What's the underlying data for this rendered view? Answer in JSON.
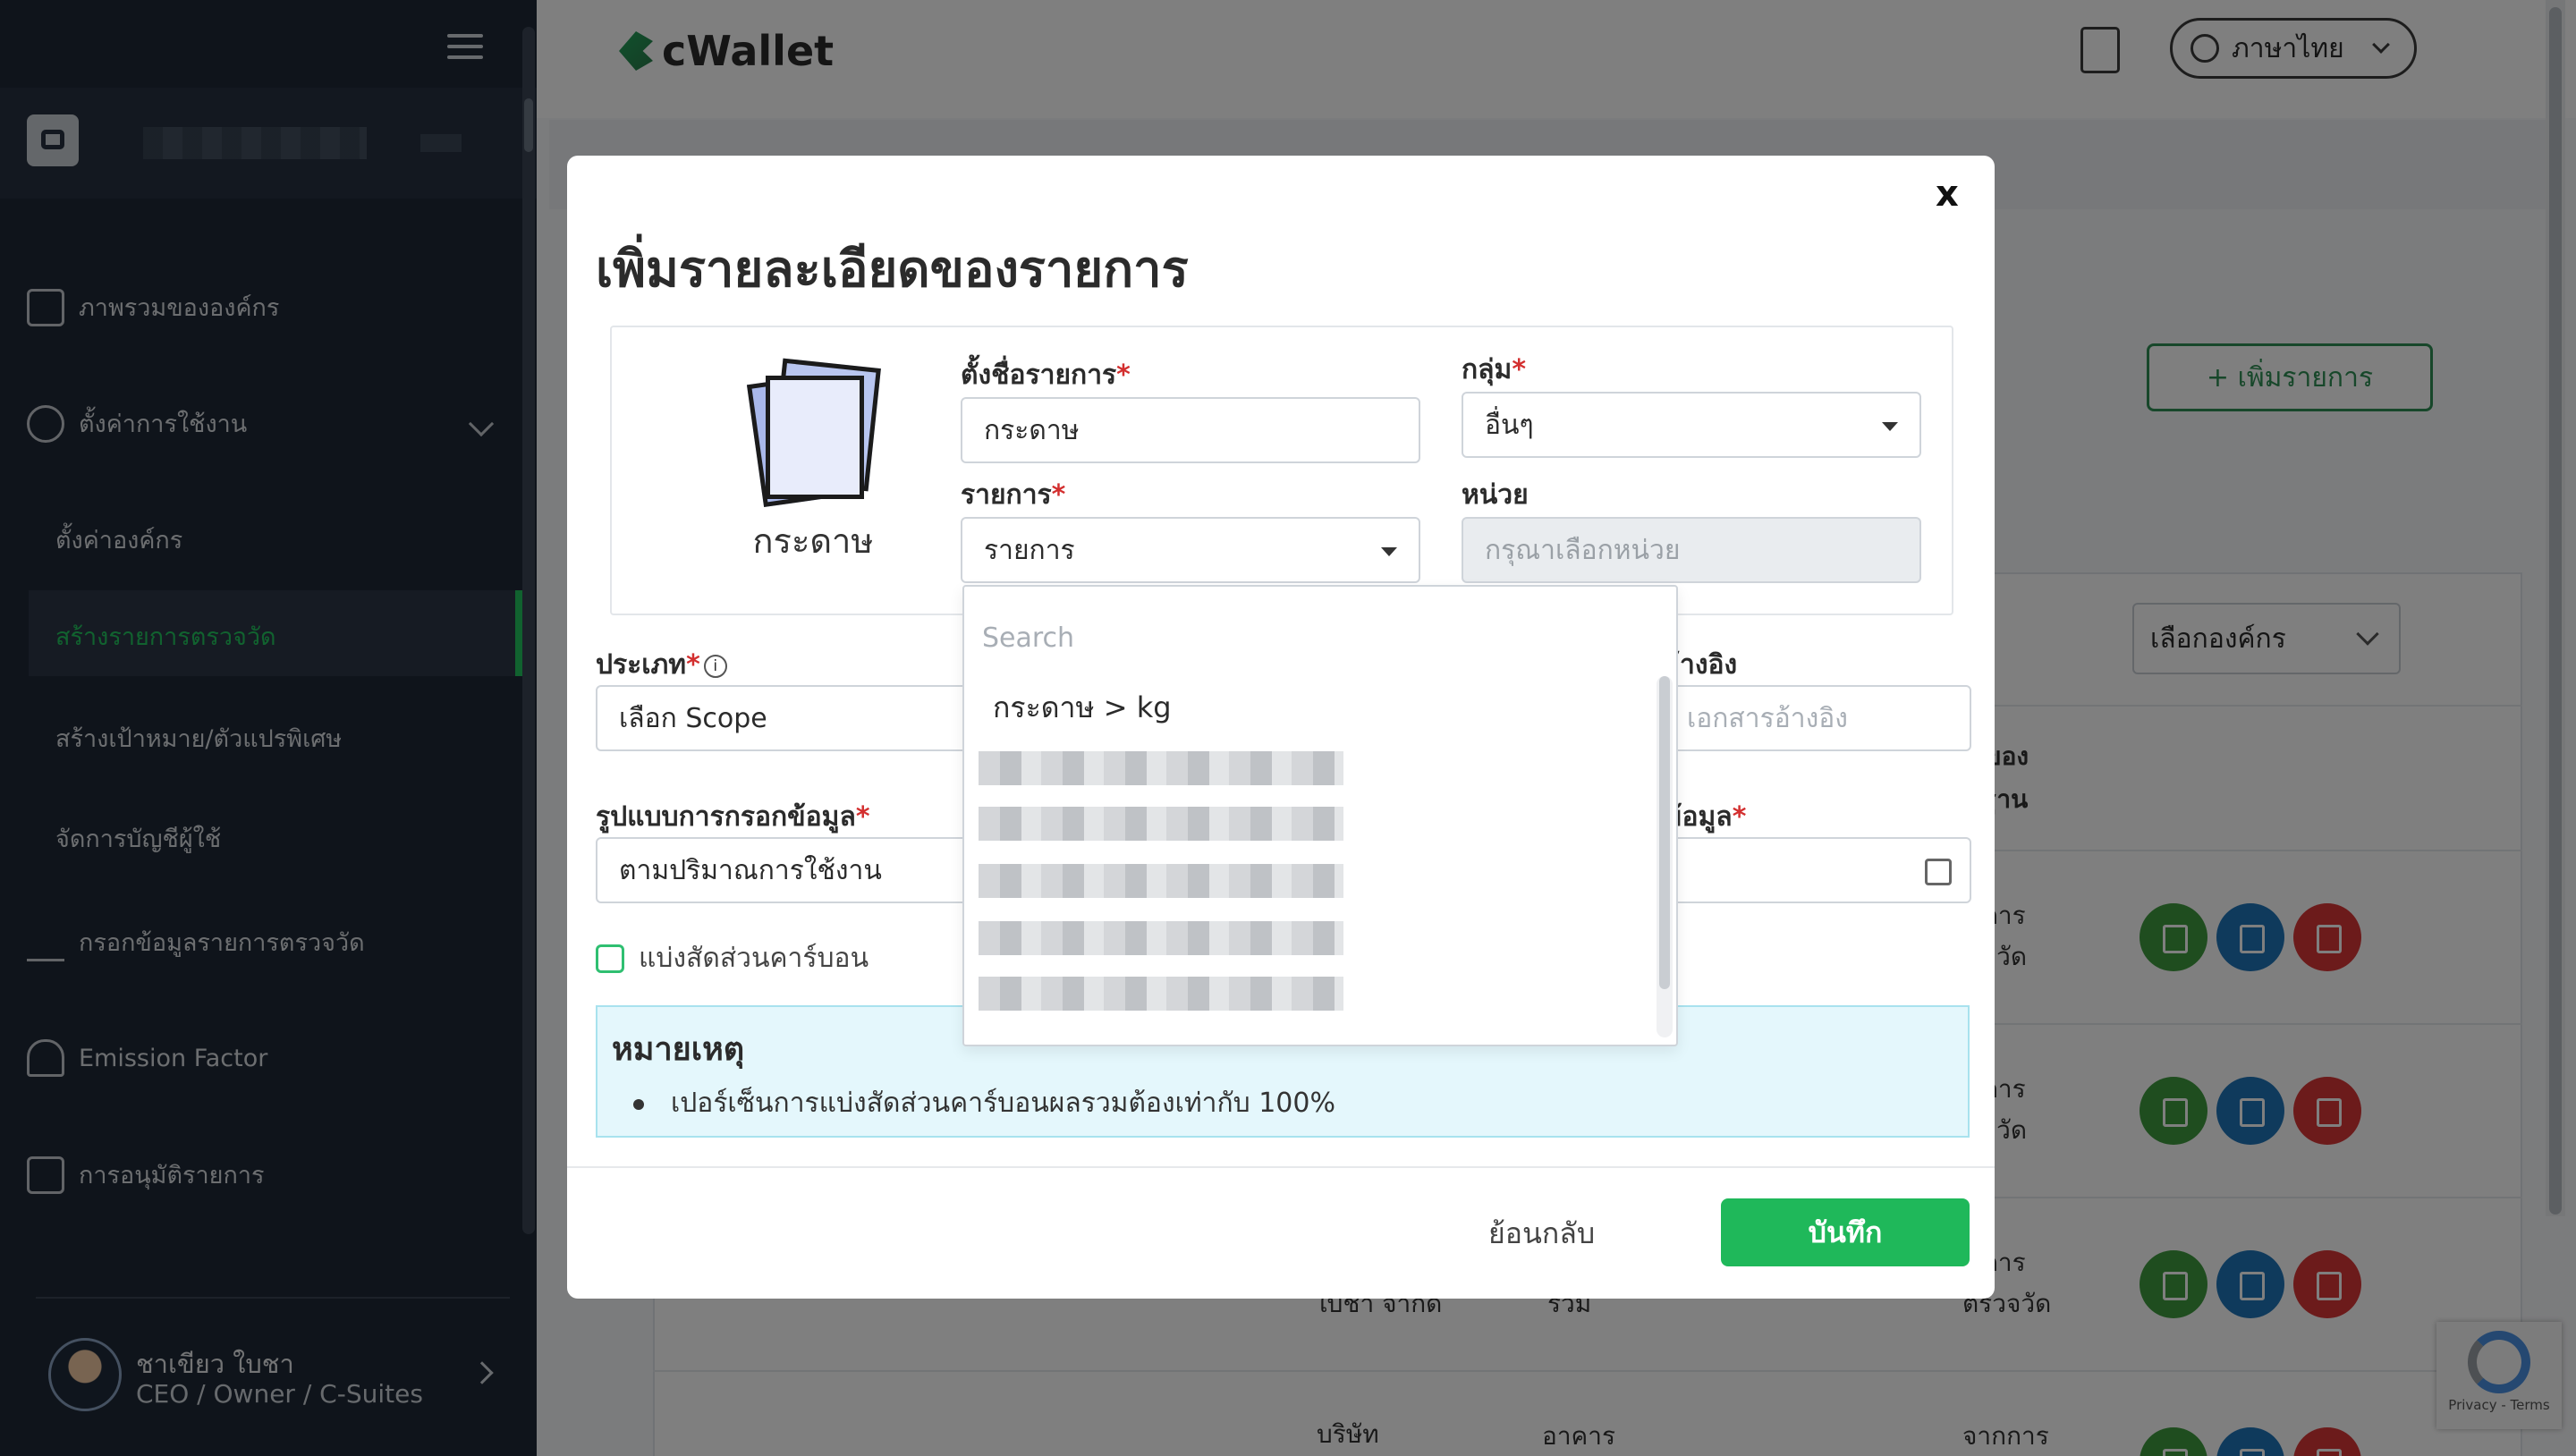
{
  "sidebar": {
    "items": [
      {
        "label": "ภาพรวมขององค์กร",
        "icon": "dashboard-icon"
      },
      {
        "label": "ตั้งค่าการใช้งาน",
        "icon": "gear-icon"
      },
      {
        "label": "กรอกข้อมูลรายการตรวจวัด",
        "icon": "pencil-icon"
      },
      {
        "label": "Emission Factor",
        "icon": "cloud-icon"
      },
      {
        "label": "การอนุมัติรายการ",
        "icon": "approval-icon"
      }
    ],
    "sub_items": [
      {
        "label": "ตั้งค่าองค์กร"
      },
      {
        "label": "สร้างรายการตรวจวัด",
        "active": true
      },
      {
        "label": "สร้างเป้าหมาย/ตัวแปรพิเศษ"
      },
      {
        "label": "จัดการบัญชีผู้ใช้"
      }
    ],
    "user": {
      "name": "ชาเขียว ใบชา",
      "role": "CEO / Owner / C-Suites"
    }
  },
  "header": {
    "logo_text": "cWallet",
    "language": "ภาษาไทย"
  },
  "page": {
    "add_button": "+ เพิ่มรายการ",
    "org_select": "เลือกองค์กร",
    "table_fragments": [
      "ทของ",
      "กฐาน",
      "กการ",
      "วจวัด",
      "กการ",
      "วจวัด",
      "ใบชา จากด",
      "รวม",
      "กการ",
      "ตรวจวัด",
      "บริษัท",
      "อาคาร",
      "จากการ"
    ]
  },
  "modal": {
    "close_label": "x",
    "title": "เพิ่มรายละเอียดของรายการ",
    "item_icon_label": "กระดาษ",
    "fields": {
      "name": {
        "label": "ตั้งชื่อรายการ",
        "value": "กระดาษ"
      },
      "group": {
        "label": "กลุ่ม",
        "value": "อื่นๆ"
      },
      "item": {
        "label": "รายการ",
        "value": "รายการ"
      },
      "unit": {
        "label": "หน่วย",
        "placeholder": "กรุณาเลือกหน่วย"
      },
      "type": {
        "label": "ประเภท",
        "value": "เลือก Scope"
      },
      "reference": {
        "label": "อ้างอิง",
        "placeholder": "เอกสารอ้างอิง"
      },
      "input_format": {
        "label": "รูปแบบการกรอกข้อมูล",
        "value": "ตามปริมาณการใช้งาน"
      },
      "data_date": {
        "label": "ข้อมูล"
      }
    },
    "carbon_split_label": "แบ่งสัดส่วนคาร์บอน",
    "note": {
      "title": "หมายเหตุ",
      "item": "เปอร์เซ็นการแบ่งสัดส่วนคาร์บอนผลรวมต้องเท่ากับ 100%"
    },
    "back_label": "ย้อนกลับ",
    "save_label": "บันทึก",
    "dropdown": {
      "search_placeholder": "Search",
      "options": [
        "กระดาษ > kg"
      ]
    }
  },
  "recaptcha": {
    "text": "Privacy - Terms"
  },
  "colors": {
    "sidebar_bg": "#1f2937",
    "accent_green": "#22c55e",
    "save_green": "#1fb85a",
    "required_red": "#d32f2f"
  }
}
